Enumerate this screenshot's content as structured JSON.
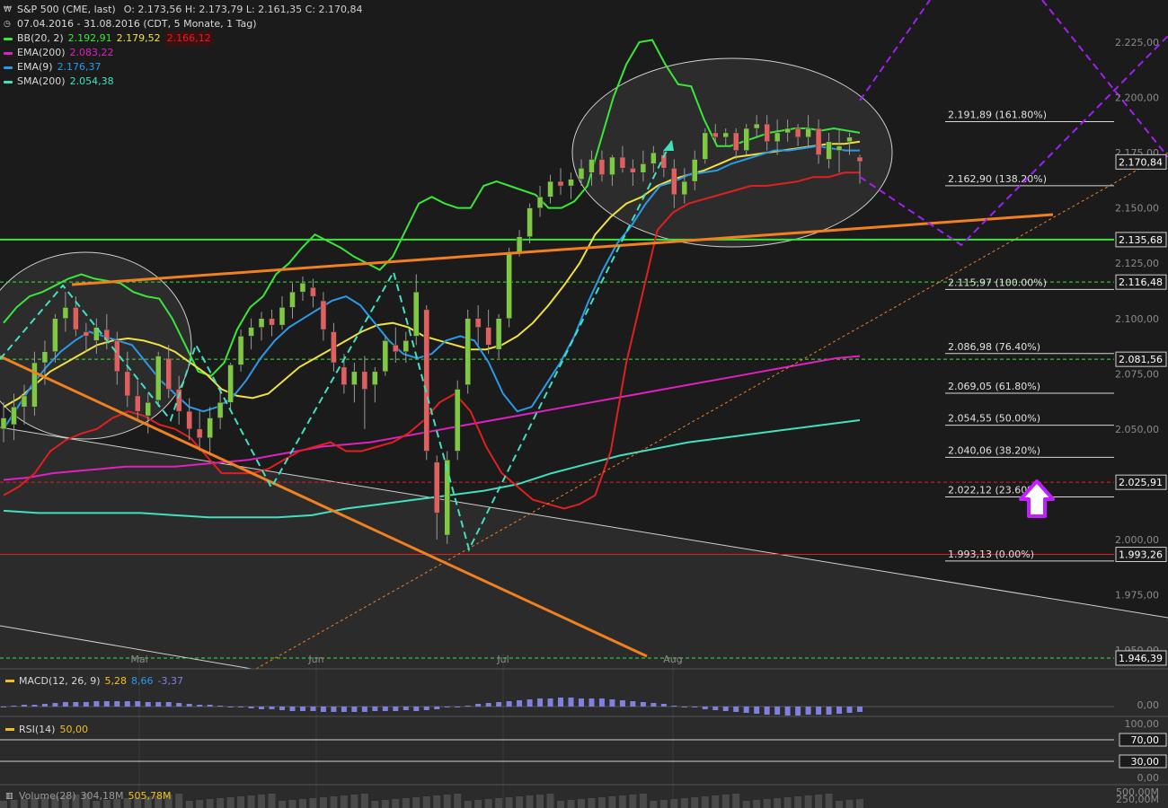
{
  "header": {
    "instrument": "S&P 500 (CME, last)",
    "ohlc": "O: 2.173,56  H: 2.173,79  L: 2.161,35  C: 2.170,84",
    "range": "07.04.2016 - 31.08.2016 (CDT, 5 Monate, 1 Tag)"
  },
  "legend": [
    {
      "label": "BB(20, 2)",
      "values": [
        "2.192,91",
        "2.179,52",
        "2.166,12"
      ],
      "colors": [
        "#39e639",
        "#f0e040",
        "#e02020"
      ],
      "swatch": "#39e639"
    },
    {
      "label": "EMA(200)",
      "values": [
        "2.083,22"
      ],
      "colors": [
        "#e020c0"
      ],
      "swatch": "#e020c0"
    },
    {
      "label": "EMA(9)",
      "values": [
        "2.176,37"
      ],
      "colors": [
        "#2a9ae8"
      ],
      "swatch": "#2a9ae8"
    },
    {
      "label": "SMA(200)",
      "values": [
        "2.054,38"
      ],
      "colors": [
        "#40e0c0"
      ],
      "swatch": "#40e0c0"
    }
  ],
  "colors": {
    "background": "#1b1b1b",
    "up": "#7fc843",
    "down": "#e06060",
    "bb_upper": "#39e639",
    "bb_mid": "#f0e040",
    "bb_lower": "#e02020",
    "ema200": "#e020c0",
    "ema9": "#2a9ae8",
    "sma200": "#40e0c0",
    "trend_orange": "#f08020",
    "projection": "#a020f0",
    "fib_line": "#d8d8d8",
    "arrow": "#c020ff",
    "macd_hist": "#8080e0",
    "rsi": "#f0c020"
  },
  "chart_data": {
    "type": "candlestick",
    "title": "S&P 500 (CME, last)",
    "ylim": [
      1946,
      2240
    ],
    "y_ticks": [
      "2.225,00",
      "2.200,00",
      "2.175,00",
      "2.150,00",
      "2.125,00",
      "2.100,00",
      "2.075,00",
      "2.050,00",
      "2.025,00",
      "2.000,00",
      "1.975,00",
      "1.950,00"
    ],
    "x_month_labels": [
      "Mai",
      "Jun",
      "Jul",
      "Aug"
    ],
    "candles": [
      {
        "o": 2050,
        "h": 2062,
        "l": 2044,
        "c": 2055
      },
      {
        "o": 2052,
        "h": 2066,
        "l": 2045,
        "c": 2060
      },
      {
        "o": 2060,
        "h": 2070,
        "l": 2052,
        "c": 2065
      },
      {
        "o": 2060,
        "h": 2085,
        "l": 2056,
        "c": 2080
      },
      {
        "o": 2080,
        "h": 2090,
        "l": 2070,
        "c": 2085
      },
      {
        "o": 2085,
        "h": 2102,
        "l": 2080,
        "c": 2100
      },
      {
        "o": 2100,
        "h": 2112,
        "l": 2094,
        "c": 2105
      },
      {
        "o": 2105,
        "h": 2110,
        "l": 2092,
        "c": 2095
      },
      {
        "o": 2094,
        "h": 2098,
        "l": 2085,
        "c": 2092
      },
      {
        "o": 2090,
        "h": 2100,
        "l": 2084,
        "c": 2096
      },
      {
        "o": 2095,
        "h": 2102,
        "l": 2086,
        "c": 2090
      },
      {
        "o": 2090,
        "h": 2094,
        "l": 2070,
        "c": 2076
      },
      {
        "o": 2076,
        "h": 2085,
        "l": 2060,
        "c": 2065
      },
      {
        "o": 2065,
        "h": 2072,
        "l": 2054,
        "c": 2058
      },
      {
        "o": 2056,
        "h": 2066,
        "l": 2048,
        "c": 2062
      },
      {
        "o": 2063,
        "h": 2085,
        "l": 2060,
        "c": 2083
      },
      {
        "o": 2082,
        "h": 2088,
        "l": 2064,
        "c": 2068
      },
      {
        "o": 2068,
        "h": 2074,
        "l": 2052,
        "c": 2058
      },
      {
        "o": 2058,
        "h": 2064,
        "l": 2045,
        "c": 2050
      },
      {
        "o": 2050,
        "h": 2058,
        "l": 2040,
        "c": 2046
      },
      {
        "o": 2046,
        "h": 2060,
        "l": 2038,
        "c": 2055
      },
      {
        "o": 2055,
        "h": 2068,
        "l": 2050,
        "c": 2062
      },
      {
        "o": 2062,
        "h": 2080,
        "l": 2058,
        "c": 2079
      },
      {
        "o": 2079,
        "h": 2095,
        "l": 2076,
        "c": 2092
      },
      {
        "o": 2092,
        "h": 2100,
        "l": 2086,
        "c": 2096
      },
      {
        "o": 2096,
        "h": 2103,
        "l": 2090,
        "c": 2100
      },
      {
        "o": 2100,
        "h": 2104,
        "l": 2092,
        "c": 2097
      },
      {
        "o": 2097,
        "h": 2110,
        "l": 2095,
        "c": 2105
      },
      {
        "o": 2105,
        "h": 2116,
        "l": 2100,
        "c": 2112
      },
      {
        "o": 2112,
        "h": 2119,
        "l": 2108,
        "c": 2116
      },
      {
        "o": 2114,
        "h": 2118,
        "l": 2105,
        "c": 2110
      },
      {
        "o": 2108,
        "h": 2112,
        "l": 2090,
        "c": 2095
      },
      {
        "o": 2094,
        "h": 2098,
        "l": 2076,
        "c": 2080
      },
      {
        "o": 2078,
        "h": 2084,
        "l": 2066,
        "c": 2070
      },
      {
        "o": 2070,
        "h": 2080,
        "l": 2062,
        "c": 2076
      },
      {
        "o": 2076,
        "h": 2083,
        "l": 2050,
        "c": 2068
      },
      {
        "o": 2070,
        "h": 2078,
        "l": 2062,
        "c": 2076
      },
      {
        "o": 2076,
        "h": 2092,
        "l": 2074,
        "c": 2090
      },
      {
        "o": 2088,
        "h": 2096,
        "l": 2080,
        "c": 2085
      },
      {
        "o": 2085,
        "h": 2094,
        "l": 2080,
        "c": 2090
      },
      {
        "o": 2092,
        "h": 2120,
        "l": 2088,
        "c": 2112
      },
      {
        "o": 2104,
        "h": 2106,
        "l": 2036,
        "c": 2040
      },
      {
        "o": 2035,
        "h": 2038,
        "l": 2000,
        "c": 2012
      },
      {
        "o": 2002,
        "h": 2040,
        "l": 1998,
        "c": 2036
      },
      {
        "o": 2040,
        "h": 2072,
        "l": 2036,
        "c": 2068
      },
      {
        "o": 2070,
        "h": 2104,
        "l": 2066,
        "c": 2100
      },
      {
        "o": 2100,
        "h": 2106,
        "l": 2088,
        "c": 2096
      },
      {
        "o": 2096,
        "h": 2104,
        "l": 2084,
        "c": 2088
      },
      {
        "o": 2086,
        "h": 2102,
        "l": 2082,
        "c": 2100
      },
      {
        "o": 2100,
        "h": 2132,
        "l": 2096,
        "c": 2130
      },
      {
        "o": 2130,
        "h": 2140,
        "l": 2128,
        "c": 2137
      },
      {
        "o": 2137,
        "h": 2152,
        "l": 2134,
        "c": 2150
      },
      {
        "o": 2150,
        "h": 2160,
        "l": 2146,
        "c": 2155
      },
      {
        "o": 2155,
        "h": 2165,
        "l": 2152,
        "c": 2162
      },
      {
        "o": 2162,
        "h": 2168,
        "l": 2156,
        "c": 2160
      },
      {
        "o": 2160,
        "h": 2166,
        "l": 2154,
        "c": 2163
      },
      {
        "o": 2163,
        "h": 2172,
        "l": 2160,
        "c": 2168
      },
      {
        "o": 2166,
        "h": 2176,
        "l": 2160,
        "c": 2172
      },
      {
        "o": 2172,
        "h": 2176,
        "l": 2162,
        "c": 2165
      },
      {
        "o": 2165,
        "h": 2174,
        "l": 2160,
        "c": 2173
      },
      {
        "o": 2173,
        "h": 2178,
        "l": 2166,
        "c": 2168
      },
      {
        "o": 2168,
        "h": 2172,
        "l": 2160,
        "c": 2166
      },
      {
        "o": 2166,
        "h": 2176,
        "l": 2162,
        "c": 2170
      },
      {
        "o": 2170,
        "h": 2178,
        "l": 2166,
        "c": 2175
      },
      {
        "o": 2174,
        "h": 2176,
        "l": 2164,
        "c": 2168
      },
      {
        "o": 2168,
        "h": 2172,
        "l": 2150,
        "c": 2156
      },
      {
        "o": 2156,
        "h": 2168,
        "l": 2152,
        "c": 2162
      },
      {
        "o": 2162,
        "h": 2176,
        "l": 2158,
        "c": 2172
      },
      {
        "o": 2172,
        "h": 2186,
        "l": 2170,
        "c": 2184
      },
      {
        "o": 2184,
        "h": 2188,
        "l": 2180,
        "c": 2182
      },
      {
        "o": 2182,
        "h": 2186,
        "l": 2178,
        "c": 2184
      },
      {
        "o": 2184,
        "h": 2186,
        "l": 2172,
        "c": 2176
      },
      {
        "o": 2176,
        "h": 2188,
        "l": 2174,
        "c": 2186
      },
      {
        "o": 2186,
        "h": 2192,
        "l": 2182,
        "c": 2188
      },
      {
        "o": 2188,
        "h": 2192,
        "l": 2176,
        "c": 2180
      },
      {
        "o": 2180,
        "h": 2190,
        "l": 2174,
        "c": 2184
      },
      {
        "o": 2184,
        "h": 2190,
        "l": 2180,
        "c": 2186
      },
      {
        "o": 2186,
        "h": 2188,
        "l": 2178,
        "c": 2182
      },
      {
        "o": 2182,
        "h": 2192,
        "l": 2178,
        "c": 2186
      },
      {
        "o": 2186,
        "h": 2190,
        "l": 2170,
        "c": 2174
      },
      {
        "o": 2172,
        "h": 2184,
        "l": 2168,
        "c": 2180
      },
      {
        "o": 2176,
        "h": 2186,
        "l": 2166,
        "c": 2178
      },
      {
        "o": 2180,
        "h": 2184,
        "l": 2174,
        "c": 2182
      },
      {
        "o": 2173,
        "h": 2174,
        "l": 2161,
        "c": 2171
      }
    ],
    "bb_upper": [
      2098,
      2105,
      2110,
      2112,
      2115,
      2118,
      2120,
      2118,
      2117,
      2116,
      2112,
      2110,
      2109,
      2100,
      2088,
      2076,
      2074,
      2080,
      2095,
      2105,
      2110,
      2120,
      2125,
      2132,
      2138,
      2135,
      2132,
      2128,
      2125,
      2122,
      2128,
      2140,
      2152,
      2155,
      2152,
      2150,
      2150,
      2160,
      2162,
      2160,
      2158,
      2156,
      2150,
      2150,
      2153,
      2160,
      2180,
      2200,
      2215,
      2225,
      2226,
      2215,
      2206,
      2205,
      2190,
      2178,
      2178,
      2180,
      2182,
      2184,
      2185,
      2186,
      2186,
      2185,
      2186,
      2185,
      2184
    ],
    "bb_mid": [
      2060,
      2064,
      2070,
      2076,
      2080,
      2084,
      2088,
      2090,
      2091,
      2090,
      2088,
      2085,
      2080,
      2075,
      2068,
      2065,
      2064,
      2066,
      2072,
      2078,
      2082,
      2086,
      2090,
      2094,
      2097,
      2098,
      2096,
      2092,
      2090,
      2088,
      2086,
      2086,
      2088,
      2092,
      2098,
      2106,
      2115,
      2125,
      2138,
      2146,
      2152,
      2155,
      2160,
      2163,
      2165,
      2167,
      2170,
      2173,
      2174,
      2175,
      2176,
      2177,
      2178,
      2179,
      2179,
      2180
    ],
    "bb_lower": [
      2020,
      2024,
      2030,
      2040,
      2045,
      2048,
      2050,
      2055,
      2058,
      2056,
      2052,
      2050,
      2046,
      2038,
      2030,
      2030,
      2030,
      2032,
      2036,
      2040,
      2042,
      2044,
      2040,
      2040,
      2042,
      2044,
      2048,
      2054,
      2062,
      2066,
      2058,
      2042,
      2030,
      2024,
      2018,
      2016,
      2014,
      2016,
      2020,
      2040,
      2080,
      2110,
      2140,
      2148,
      2152,
      2154,
      2156,
      2158,
      2160,
      2160,
      2161,
      2162,
      2164,
      2164,
      2166,
      2166
    ],
    "ema9": [
      2050,
      2060,
      2070,
      2078,
      2085,
      2090,
      2094,
      2092,
      2090,
      2088,
      2080,
      2072,
      2066,
      2060,
      2058,
      2060,
      2064,
      2072,
      2082,
      2090,
      2096,
      2100,
      2104,
      2108,
      2110,
      2106,
      2098,
      2090,
      2084,
      2082,
      2084,
      2090,
      2092,
      2090,
      2080,
      2066,
      2058,
      2060,
      2070,
      2080,
      2092,
      2108,
      2122,
      2134,
      2142,
      2152,
      2160,
      2162,
      2165,
      2166,
      2167,
      2170,
      2172,
      2174,
      2176,
      2176,
      2177,
      2178,
      2177,
      2176,
      2176
    ],
    "ema200": [
      2027,
      2028,
      2030,
      2031,
      2032,
      2033,
      2033,
      2033,
      2034,
      2035,
      2036,
      2038,
      2040,
      2042,
      2043,
      2044,
      2046,
      2048,
      2050,
      2052,
      2054,
      2056,
      2058,
      2060,
      2062,
      2064,
      2066,
      2068,
      2070,
      2072,
      2074,
      2076,
      2078,
      2080,
      2082,
      2083
    ],
    "sma200": [
      2013,
      2012,
      2012,
      2012,
      2012,
      2011,
      2010,
      2010,
      2010,
      2011,
      2014,
      2016,
      2018,
      2020,
      2022,
      2025,
      2030,
      2034,
      2038,
      2041,
      2044,
      2046,
      2048,
      2050,
      2052,
      2054
    ],
    "horizontal_levels": [
      {
        "price": 2135.68,
        "label": "2.135,68",
        "style": "solid",
        "color": "#39e639"
      },
      {
        "price": 2116.48,
        "label": "2.116,48",
        "style": "dashed",
        "color": "#39e639"
      },
      {
        "price": 2081.56,
        "label": "2.081,56",
        "style": "dashed",
        "color": "#39e639"
      },
      {
        "price": 2025.91,
        "label": "2.025,91",
        "style": "dashed",
        "color": "#e02020"
      },
      {
        "price": 1993.26,
        "label": "1.993,26",
        "style": "solid",
        "color": "#e02020"
      },
      {
        "price": 1946.39,
        "label": "1.946,39",
        "style": "dashed",
        "color": "#39e639"
      }
    ],
    "last_price": {
      "price": 2170.84,
      "label": "2.170,84"
    },
    "fibonacci": [
      {
        "price": 2191.89,
        "label": "2.191,89 (161.80%)"
      },
      {
        "price": 2162.9,
        "label": "2.162,90 (138.20%)"
      },
      {
        "price": 2115.97,
        "label": "2.115,97 (100.00%)"
      },
      {
        "price": 2086.98,
        "label": "2.086,98 (76.40%)"
      },
      {
        "price": 2069.05,
        "label": "2.069,05 (61.80%)"
      },
      {
        "price": 2054.55,
        "label": "2.054,55 (50.00%)"
      },
      {
        "price": 2040.06,
        "label": "2.040,06 (38.20%)"
      },
      {
        "price": 2022.12,
        "label": "2.022,12 (23.60%)"
      },
      {
        "price": 1993.13,
        "label": "1.993,13 (0.00%)"
      }
    ]
  },
  "macd": {
    "label": "MACD(12, 26, 9)",
    "v1": "5,28",
    "v2": "8,66",
    "v3": "-3,37",
    "zero_label": "0,00"
  },
  "rsi": {
    "label": "RSI(14)",
    "value": "50,00",
    "ticks": [
      "100,00",
      "70,00",
      "30,00",
      "0,00"
    ]
  },
  "volume": {
    "label": "Volume(28)",
    "v1": "304,18M",
    "v2": "505,78M",
    "ticks": [
      "500,00M",
      "250,00M"
    ]
  }
}
